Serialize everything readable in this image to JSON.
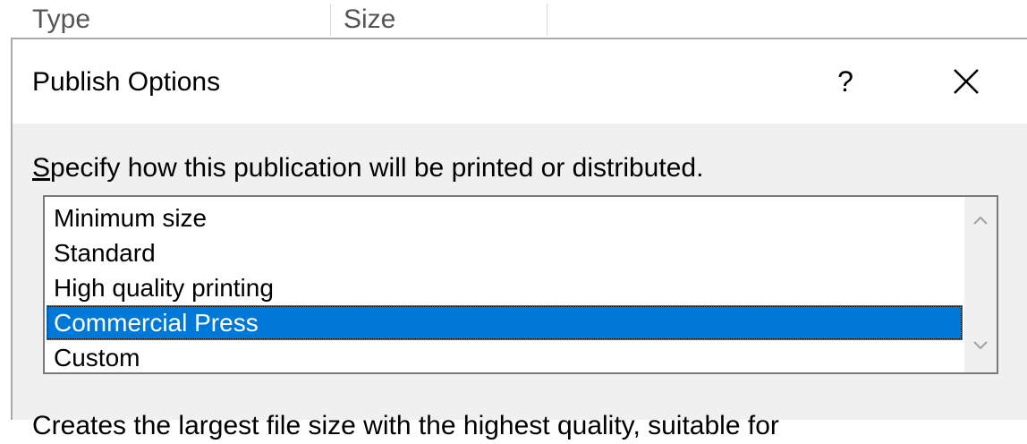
{
  "background": {
    "columns": [
      {
        "label": "Type"
      },
      {
        "label": "Size"
      }
    ]
  },
  "dialog": {
    "title": "Publish Options",
    "help_label": "?",
    "close_icon": "close-icon",
    "prompt_accel": "S",
    "prompt_rest": "pecify how this publication will be printed or distributed.",
    "list": {
      "items": [
        {
          "label": "Minimum size"
        },
        {
          "label": "Standard"
        },
        {
          "label": "High quality printing"
        },
        {
          "label": "Commercial Press"
        },
        {
          "label": "Custom"
        }
      ],
      "selected": "Commercial Press",
      "selected_color": "#0078d7"
    },
    "description": "Creates the largest file size with the highest quality, suitable for"
  }
}
